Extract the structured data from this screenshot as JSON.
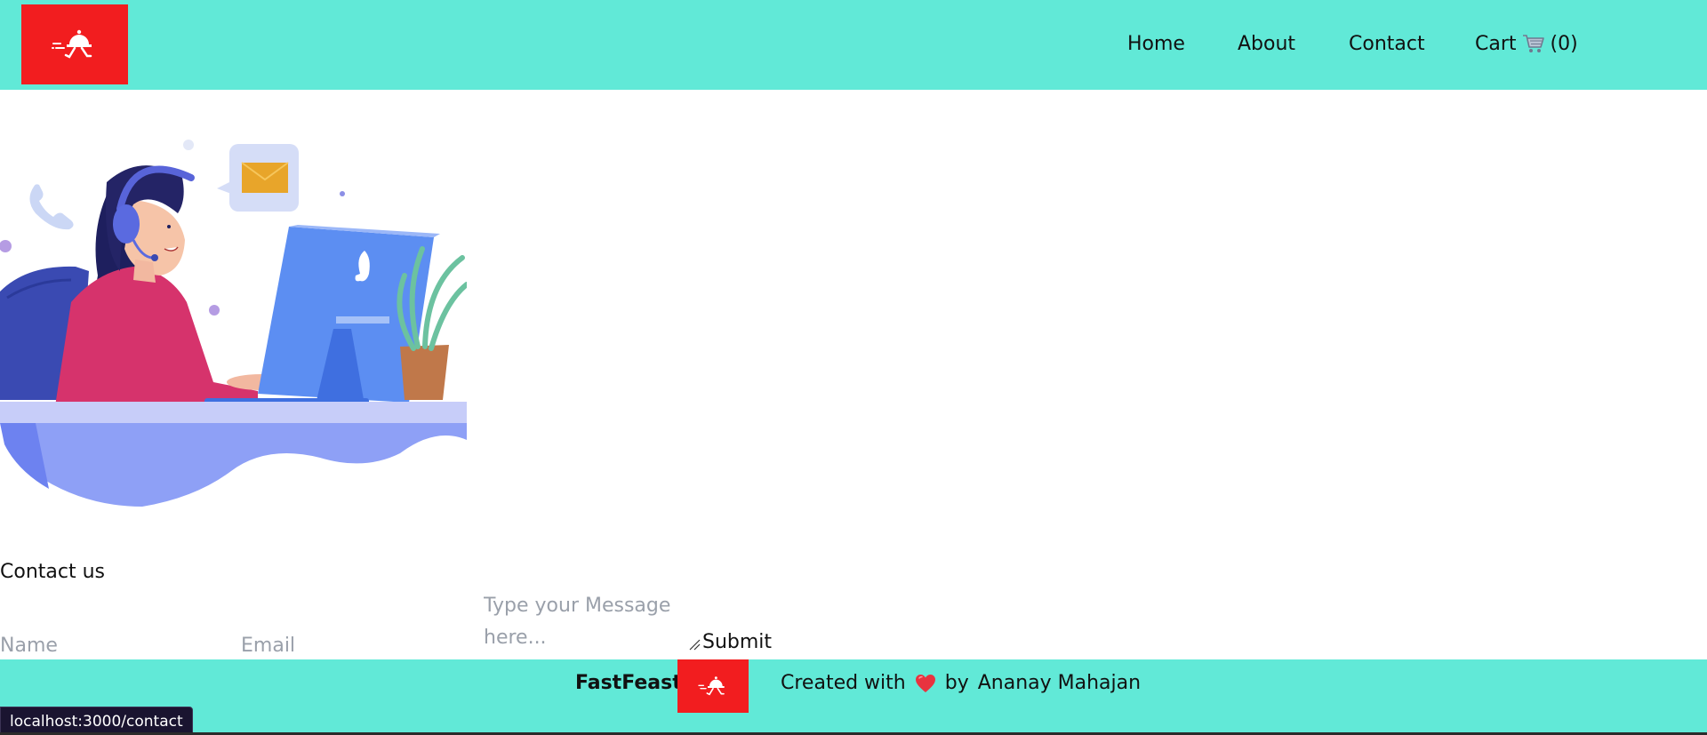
{
  "header": {
    "logo_icon": "delivery-waiter-cloche-icon",
    "nav": {
      "home": "Home",
      "about": "About",
      "contact": "Contact",
      "cart_label": "Cart",
      "cart_icon": "shopping-cart-icon",
      "cart_count": "(0)"
    }
  },
  "main": {
    "illustration": "customer-support-agent-illustration",
    "contact_title": "Contact us",
    "form": {
      "name_placeholder": "Name",
      "email_placeholder": "Email",
      "message_placeholder": "Type your Message here...",
      "submit_label": "Submit"
    }
  },
  "footer": {
    "brand": "FastFeast",
    "created_with": "Created with",
    "heart_icon": "heart-icon",
    "by": "by",
    "author": "Ananay Mahajan"
  },
  "status_bar": {
    "url": "localhost:3000/contact"
  },
  "colors": {
    "header_bg": "#61e9d7",
    "logo_bg": "#f21d1f",
    "placeholder": "#9aa0aa",
    "status_bar_bg": "#1a1430"
  }
}
